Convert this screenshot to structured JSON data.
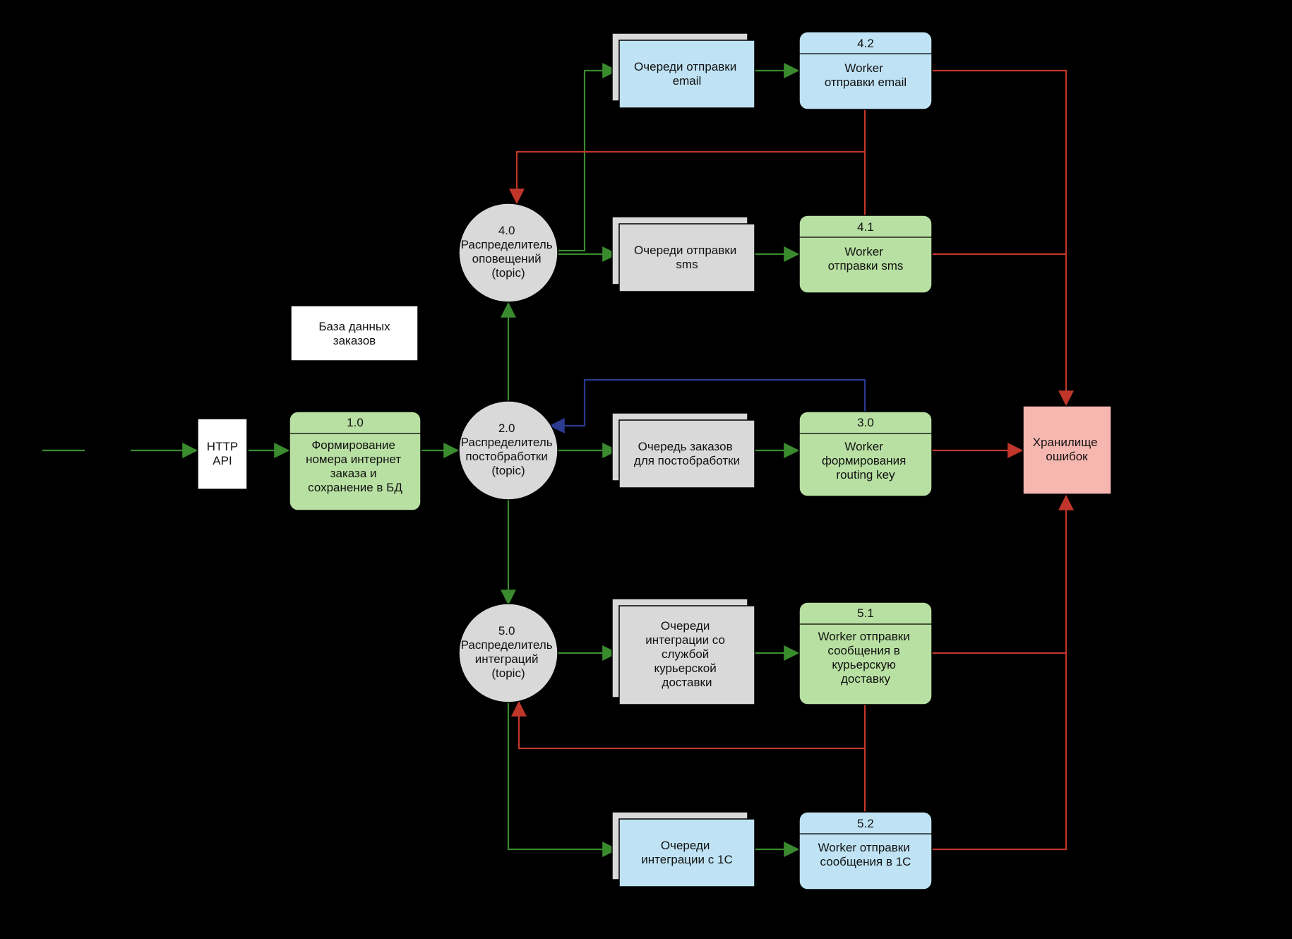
{
  "nodes": {
    "http_api": {
      "label": "HTTP\nAPI"
    },
    "db_orders": {
      "label": "База данных\nзаказов"
    },
    "n10": {
      "id": "1.0",
      "label": "Формирование\nномера интернет\nзаказа и\nсохранение в БД"
    },
    "n20": {
      "id": "2.0",
      "label": "Распределитель\nпостобработки\n(topic)"
    },
    "n40": {
      "id": "4.0",
      "label": "Распределитель\nоповещений\n(topic)"
    },
    "n50": {
      "id": "5.0",
      "label": "Распределитель\nинтеграций\n(topic)"
    },
    "q_email": {
      "label": "Очереди отправки\nemail"
    },
    "q_sms": {
      "label": "Очереди отправки\nsms"
    },
    "q_post": {
      "label": "Очередь заказов\nдля постобработки"
    },
    "q_courier": {
      "label": "Очереди\nинтеграции со\nслужбой\nкурьерской\nдоставки"
    },
    "q_1c": {
      "label": "Очереди\nинтеграции с 1С"
    },
    "w42": {
      "id": "4.2",
      "label": "Worker\nотправки email"
    },
    "w41": {
      "id": "4.1",
      "label": "Worker\nотправки sms"
    },
    "w30": {
      "id": "3.0",
      "label": "Worker\nформирования\nrouting key"
    },
    "w51": {
      "id": "5.1",
      "label": "Worker отправки\nсообщения в\nкурьерскую\nдоставку"
    },
    "w52": {
      "id": "5.2",
      "label": "Worker отправки\nсообщения в 1С"
    },
    "errors": {
      "label": "Хранилище\nошибок"
    }
  }
}
